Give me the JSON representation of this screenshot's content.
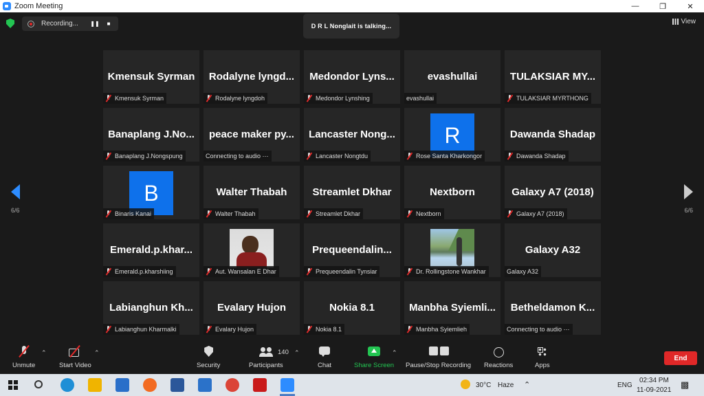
{
  "window": {
    "title": "Zoom Meeting"
  },
  "top": {
    "recording_label": "Recording...",
    "talking": "D R L Nonglait is talking...",
    "view_label": "View"
  },
  "pagination": {
    "left": "6/6",
    "right": "6/6"
  },
  "tiles": [
    {
      "big": "Kmensuk Syrman",
      "label": "Kmensuk Syrman",
      "muted": true
    },
    {
      "big": "Rodalyne  lyngd...",
      "label": "Rodalyne lyngdoh",
      "muted": true
    },
    {
      "big": "Medondor  Lyns...",
      "label": "Medondor Lynshing",
      "muted": true
    },
    {
      "big": "evashullai",
      "label": "evashullai",
      "muted": false
    },
    {
      "big": "TULAKSIAR  MY...",
      "label": "TULAKSIAR MYRTHONG",
      "muted": true
    },
    {
      "big": "Banaplang  J.No...",
      "label": "Banaplang J.Nongspung",
      "muted": true
    },
    {
      "big": "peace  maker  py...",
      "label": "Connecting to audio  ⋯",
      "muted": false
    },
    {
      "big": "Lancaster  Nong...",
      "label": "Lancaster Nongtdu",
      "muted": true
    },
    {
      "big": "",
      "avatar": "R",
      "label": "Rose Santa Kharkongor",
      "muted": true
    },
    {
      "big": "Dawanda Shadap",
      "label": "Dawanda Shadap",
      "muted": true
    },
    {
      "big": "",
      "avatar": "B",
      "label": "Binaris Kanai",
      "muted": true
    },
    {
      "big": "Walter Thabah",
      "label": "Walter Thabah",
      "muted": true
    },
    {
      "big": "Streamlet Dkhar",
      "label": "Streamlet Dkhar",
      "muted": true
    },
    {
      "big": "Nextborn",
      "label": "Nextborn",
      "muted": true
    },
    {
      "big": "Galaxy A7 (2018)",
      "label": "Galaxy A7 (2018)",
      "muted": true
    },
    {
      "big": "Emerald.p.khar...",
      "label": "Emerald.p.kharshiing",
      "muted": true
    },
    {
      "big": "",
      "photo": "photo1",
      "label": "Aut. Wansalan E Dhar",
      "muted": true
    },
    {
      "big": "Prequeendalin...",
      "label": "Prequeendalin Tynsiar",
      "muted": true
    },
    {
      "big": "",
      "photo": "photo2",
      "label": "Dr. Rollingstone Wankhar",
      "muted": true
    },
    {
      "big": "Galaxy A32",
      "label": "Galaxy A32",
      "muted": false
    },
    {
      "big": "Labianghun  Kh...",
      "label": "Labianghun Kharmalki",
      "muted": true
    },
    {
      "big": "Evalary Hujon",
      "label": "Evalary Hujon",
      "muted": true
    },
    {
      "big": "Nokia 8.1",
      "label": "Nokia 8.1",
      "muted": true
    },
    {
      "big": "Manbha  Syiemli...",
      "label": "Manbha Syiemlieh",
      "muted": true
    },
    {
      "big": "Betheldamon  K...",
      "label": "Connecting to audio  ⋯",
      "muted": false
    }
  ],
  "toolbar": {
    "unmute": "Unmute",
    "start_video": "Start Video",
    "security": "Security",
    "participants": "Participants",
    "participant_count": "140",
    "chat": "Chat",
    "share": "Share Screen",
    "pause_stop": "Pause/Stop Recording",
    "reactions": "Reactions",
    "apps": "Apps",
    "end": "End"
  },
  "taskbar": {
    "temp": "30°C",
    "weather": "Haze",
    "lang": "ENG",
    "time": "02:34 PM",
    "date": "11-09-2021"
  },
  "colors": {
    "accent": "#2d8cff",
    "share_green": "#23c552",
    "end_red": "#e02828"
  }
}
